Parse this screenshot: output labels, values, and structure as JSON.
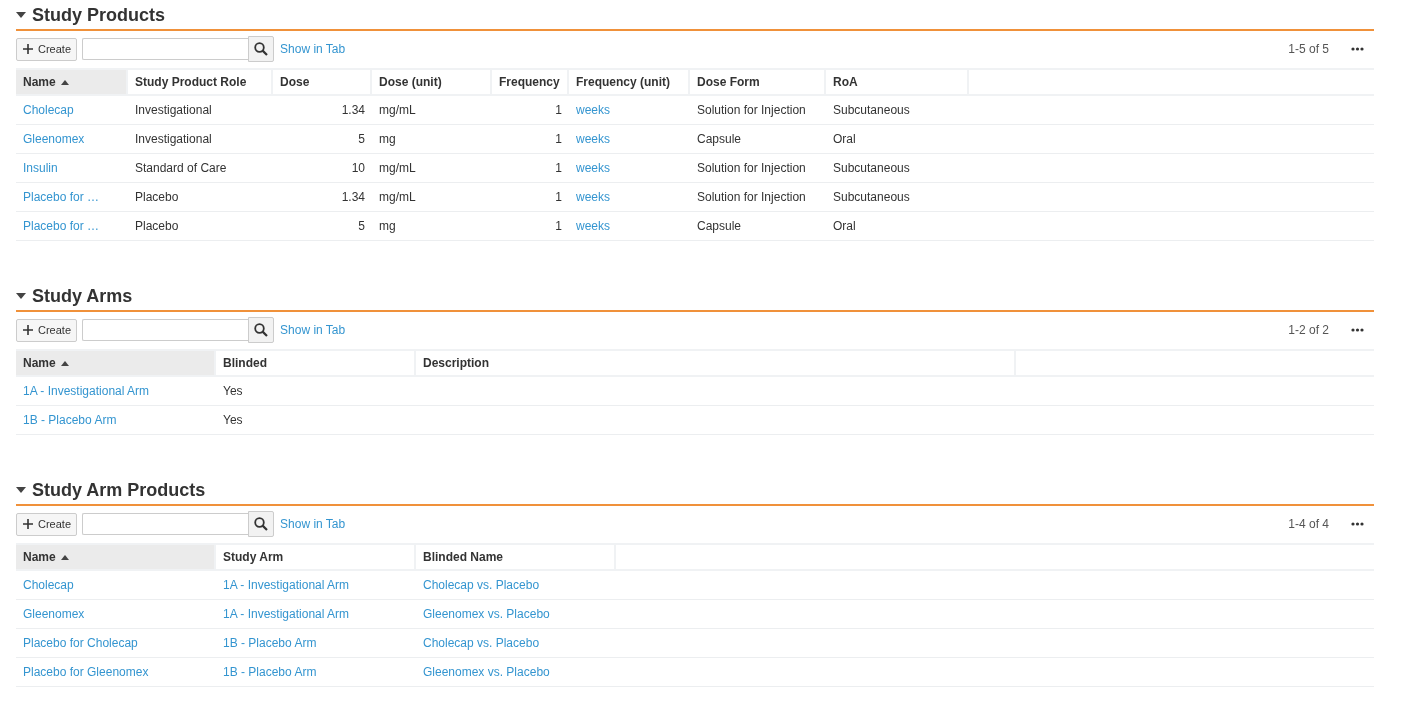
{
  "sections": [
    {
      "title": "Study Products",
      "expanded": true,
      "create_label": "Create",
      "show_in_tab": "Show in Tab",
      "paging": "1-5 of 5",
      "columns": [
        {
          "label": "Name",
          "sorted": true,
          "kind": "link"
        },
        {
          "label": "Study Product Role",
          "sorted": false,
          "kind": "text"
        },
        {
          "label": "Dose",
          "sorted": false,
          "kind": "number"
        },
        {
          "label": "Dose (unit)",
          "sorted": false,
          "kind": "text"
        },
        {
          "label": "Frequency",
          "sorted": false,
          "kind": "number"
        },
        {
          "label": "Frequency (unit)",
          "sorted": false,
          "kind": "link"
        },
        {
          "label": "Dose Form",
          "sorted": false,
          "kind": "text"
        },
        {
          "label": "RoA",
          "sorted": false,
          "kind": "text"
        }
      ],
      "rows": [
        [
          "Cholecap",
          "Investigational",
          "1.34",
          "mg/mL",
          "1",
          "weeks",
          "Solution for Injection",
          "Subcutaneous"
        ],
        [
          "Gleenomex",
          "Investigational",
          "5",
          "mg",
          "1",
          "weeks",
          "Capsule",
          "Oral"
        ],
        [
          "Insulin",
          "Standard of Care",
          "10",
          "mg/mL",
          "1",
          "weeks",
          "Solution for Injection",
          "Subcutaneous"
        ],
        [
          "Placebo for …",
          "Placebo",
          "1.34",
          "mg/mL",
          "1",
          "weeks",
          "Solution for Injection",
          "Subcutaneous"
        ],
        [
          "Placebo for …",
          "Placebo",
          "5",
          "mg",
          "1",
          "weeks",
          "Capsule",
          "Oral"
        ]
      ]
    },
    {
      "title": "Study Arms",
      "expanded": true,
      "create_label": "Create",
      "show_in_tab": "Show in Tab",
      "paging": "1-2 of 2",
      "columns": [
        {
          "label": "Name",
          "sorted": true,
          "kind": "link"
        },
        {
          "label": "Blinded",
          "sorted": false,
          "kind": "text"
        },
        {
          "label": "Description",
          "sorted": false,
          "kind": "text"
        }
      ],
      "rows": [
        [
          "1A - Investigational Arm",
          "Yes"
        ],
        [
          "1B - Placebo Arm",
          "Yes"
        ]
      ]
    },
    {
      "title": "Study Arm Products",
      "expanded": true,
      "create_label": "Create",
      "show_in_tab": "Show in Tab",
      "paging": "1-4 of 4",
      "columns": [
        {
          "label": "Name",
          "sorted": true,
          "kind": "link"
        },
        {
          "label": "Study Arm",
          "sorted": false,
          "kind": "link"
        },
        {
          "label": "Blinded Name",
          "sorted": false,
          "kind": "link"
        }
      ],
      "rows": [
        [
          "Cholecap",
          "1A - Investigational Arm",
          "Cholecap vs. Placebo"
        ],
        [
          "Gleenomex",
          "1A - Investigational Arm",
          "Gleenomex vs. Placebo"
        ],
        [
          "Placebo for Cholecap",
          "1B - Placebo Arm",
          "Cholecap vs. Placebo"
        ],
        [
          "Placebo for Gleenomex",
          "1B - Placebo Arm",
          "Gleenomex vs. Placebo"
        ]
      ]
    }
  ]
}
